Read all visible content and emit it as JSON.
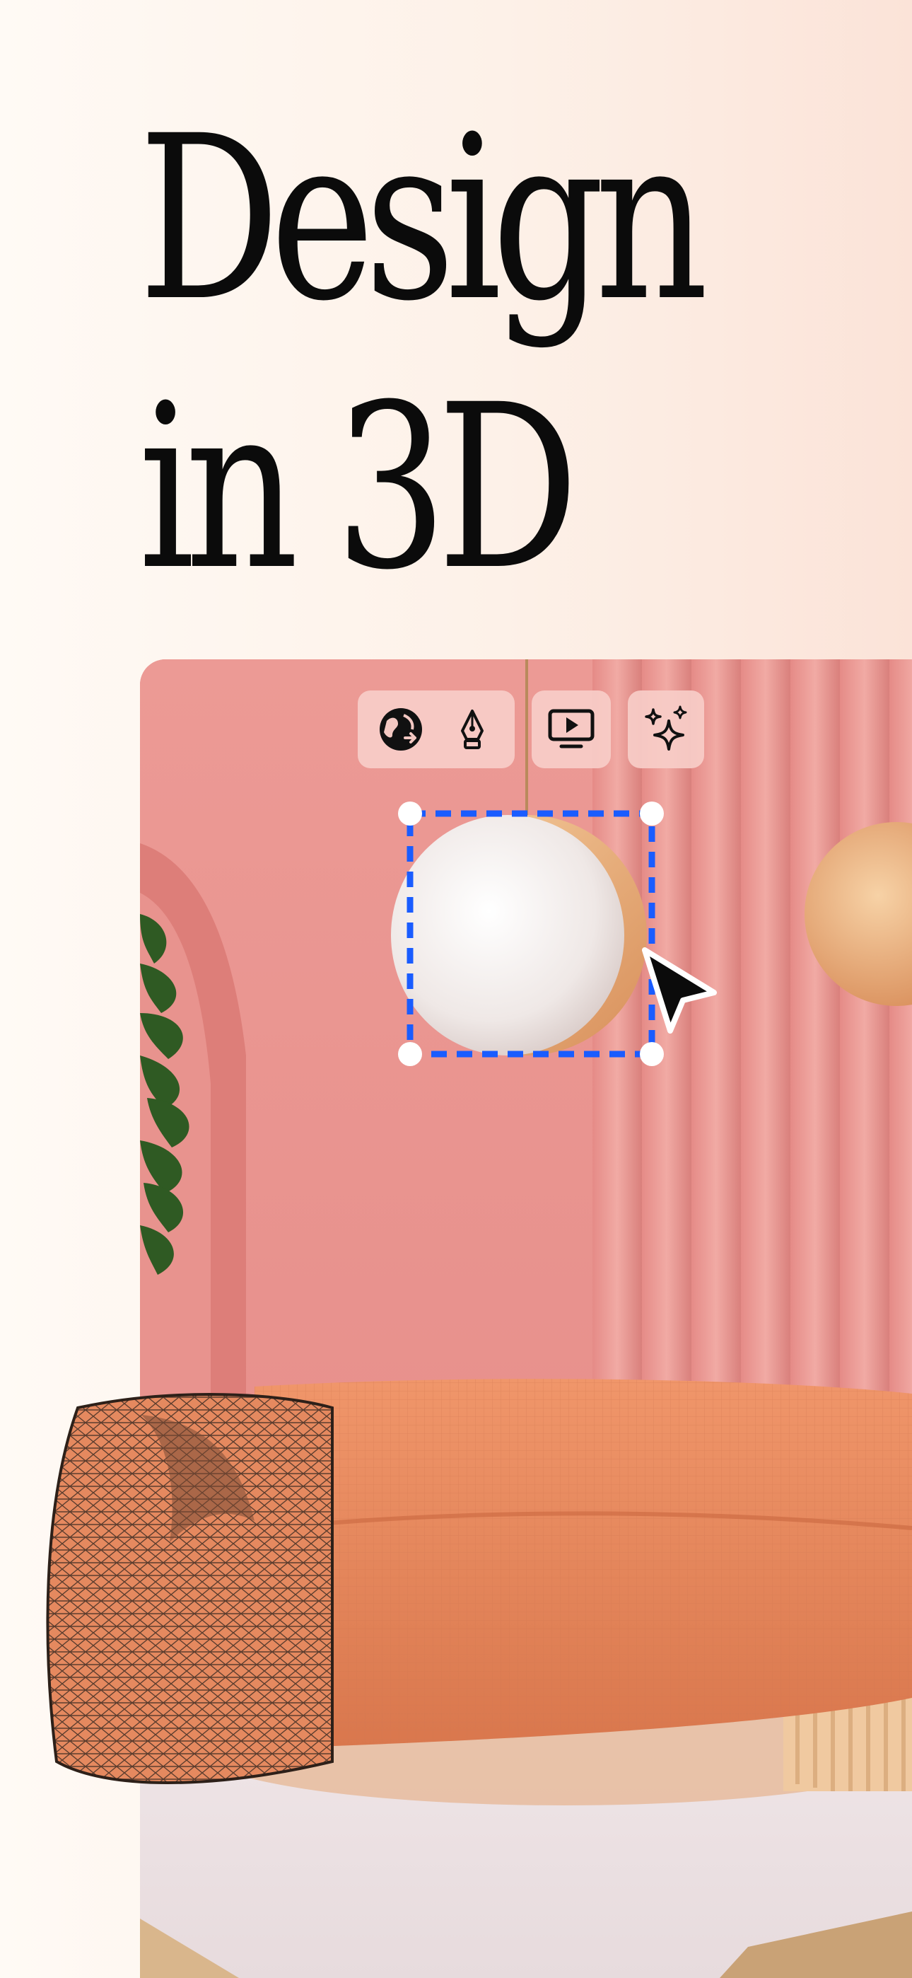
{
  "headline": {
    "line1": "Design",
    "line2": "in 3D"
  },
  "toolbar": {
    "groups": [
      {
        "tools": [
          "globe-rotate-icon",
          "pen-tool-icon"
        ]
      },
      {
        "tools": [
          "play-screen-icon"
        ]
      },
      {
        "tools": [
          "sparkles-icon"
        ]
      }
    ]
  },
  "colors": {
    "background": "#fdf1e8",
    "headline_text": "#0b0b0b",
    "wall": "#e99590",
    "selection": "#1a5cff",
    "sofa": "#e6865e",
    "lamp": "#f1ede9",
    "lamp_gold": "#e7a971"
  }
}
